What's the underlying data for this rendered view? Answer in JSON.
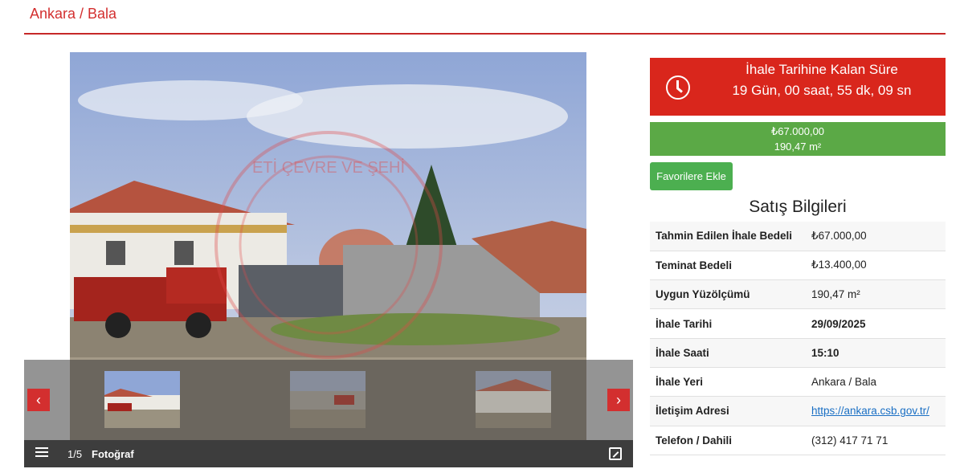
{
  "header": {
    "title": "Ankara / Bala"
  },
  "gallery": {
    "counter": "1/5",
    "caption": "Fotoğraf",
    "prev_arrow": "‹",
    "next_arrow": "›"
  },
  "countdown": {
    "title": "İhale Tarihine Kalan Süre",
    "value": "19 Gün, 00 saat, 55 dk, 09 sn"
  },
  "price": {
    "amount": "₺67.000,00",
    "area": "190,47 m²"
  },
  "favorite_button": "Favorilere Ekle",
  "sales": {
    "title": "Satış Bilgileri",
    "rows": [
      {
        "label": "Tahmin Edilen İhale Bedeli",
        "value": "₺67.000,00"
      },
      {
        "label": "Teminat Bedeli",
        "value": "₺13.400,00"
      },
      {
        "label": "Uygun Yüzölçümü",
        "value": "190,47 m²"
      },
      {
        "label": "İhale Tarihi",
        "value": "29/09/2025"
      },
      {
        "label": "İhale Saati",
        "value": "15:10"
      },
      {
        "label": "İhale Yeri",
        "value": "Ankara / Bala"
      },
      {
        "label": "İletişim Adresi",
        "value": "https://ankara.csb.gov.tr/"
      },
      {
        "label": "Telefon / Dahili",
        "value": "(312) 417 71 71"
      }
    ]
  },
  "colors": {
    "accent": "#d32f2f",
    "countdown": "#d9261c",
    "price": "#5ba946",
    "favorite": "#4caf50"
  }
}
